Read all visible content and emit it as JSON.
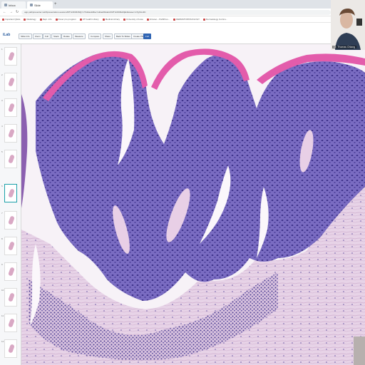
{
  "browser": {
    "tabs": [
      {
        "label": "Inbox"
      },
      {
        "label": "Slide"
      }
    ],
    "new_tab": "+",
    "url": "app.pathpresenter.net/#presentation-session/MTIxODM4NQ==/?slides&filter=slide&SlideId=MTIxODMwNjE4&case=mTgXLH3C",
    "bookmarks": [
      "Important Q&As",
      "Radiology",
      "Dept. info",
      "Rover pro program",
      "UT health Library",
      "Medical Library",
      "University of Iowa",
      "Intranet – PathPres...",
      "DERMATOPATHOLOGY",
      "Dermatology Curricu..."
    ]
  },
  "toolbar": {
    "logo": "iLab",
    "buttons": [
      "Slide Info",
      "Zoom",
      "Full",
      "Stack",
      "Rotate",
      "Measure",
      "Compare",
      "Share",
      "Back To Slides",
      "Create PDF",
      "Full"
    ]
  },
  "thumbnails": [
    "1",
    "2",
    "3",
    "4",
    "5",
    "6",
    "7",
    "8",
    "9",
    "10",
    "11",
    "12"
  ],
  "webcam": {
    "name": "Dr. Thomas Chiang"
  },
  "colors": {
    "keratin": "#e05aa8",
    "epidermis": "#6c63b8",
    "dermis": "#e9d6e8",
    "background": "#f4eef4",
    "accent": "#1aa0a8"
  }
}
